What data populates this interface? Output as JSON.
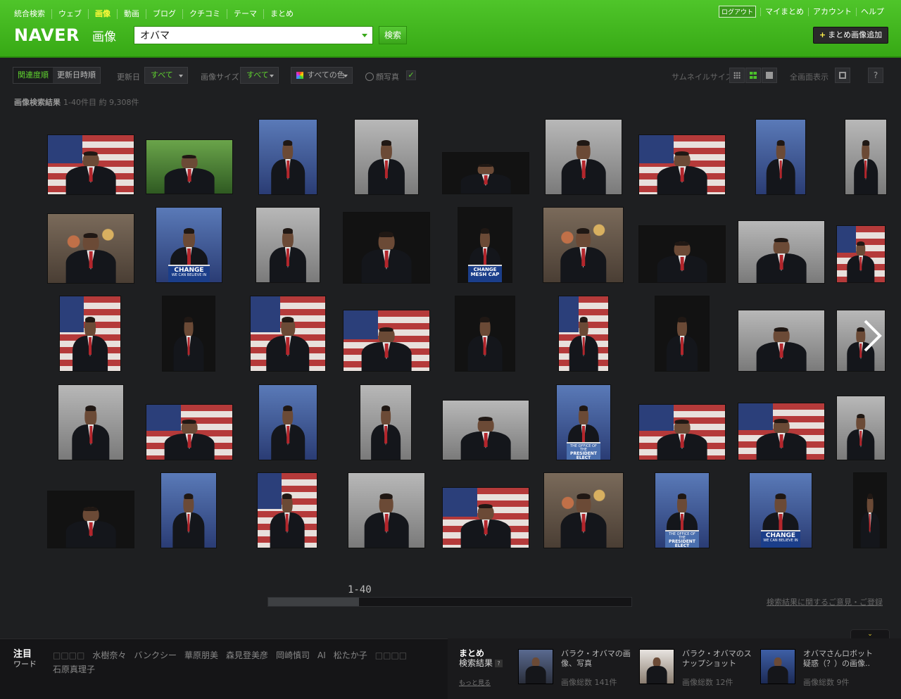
{
  "header": {
    "nav": [
      "統合検索",
      "ウェブ",
      "画像",
      "動画",
      "ブログ",
      "クチコミ",
      "テーマ",
      "まとめ"
    ],
    "nav_active": "画像",
    "util": {
      "logout": "ログアウト",
      "links": [
        "マイまとめ",
        "アカウント",
        "ヘルプ"
      ]
    },
    "logo": "NAVER",
    "logo_sub": "画像",
    "search_value": "オバマ",
    "search_button": "検索",
    "add_button": "まとめ画像追加",
    "add_plus": "+"
  },
  "toolbar": {
    "sort": [
      "関連度順",
      "更新日時順"
    ],
    "sort_active": 0,
    "updated_label": "更新日",
    "updated_value": "すべて",
    "size_label": "画像サイズ",
    "size_value": "すべて",
    "color_value": "すべての色",
    "face_label": "顔写真",
    "face_check": "✓",
    "thumb_size_label": "サムネイルサイズ",
    "fullscreen_label": "全画面表示",
    "help": "?"
  },
  "result_info": {
    "title": "画像検索結果",
    "range": "1-40件目 約 9,308件"
  },
  "pagination": {
    "label": "1-40",
    "progress_fraction": 0.5,
    "feedback": "検索結果に関するご意見・ご登録"
  },
  "footer": {
    "fold": "⌄",
    "keyword_title": "注目",
    "keyword_sub": "ワード",
    "keywords": [
      "□□□□",
      "水樹奈々",
      "バンクシー",
      "華原朋美",
      "森見登美彦",
      "岡崎慎司",
      "AI",
      "松たか子",
      "□□□□",
      "石原真理子"
    ],
    "matome_title": "まとめ",
    "matome_sub": "検索結果",
    "matome_help": "?",
    "matome_more": "もっと見る",
    "matome_cards": [
      {
        "name": "バラク・オバマの画像、写真",
        "count": "画像総数 141件"
      },
      {
        "name": "バラク・オバマのスナップショット",
        "count": "画像総数 12件"
      },
      {
        "name": "オバマさんロボット疑惑（？）の画像..",
        "count": "画像総数 9件"
      }
    ]
  },
  "podium_text": {
    "change": "CHANGE",
    "change_sub": "WE CAN BELIEVE IN",
    "mesh": "CHANGE MESH CAP",
    "office": "THE OFFICE OF THE",
    "president": "PRESIDENT ELECT"
  }
}
